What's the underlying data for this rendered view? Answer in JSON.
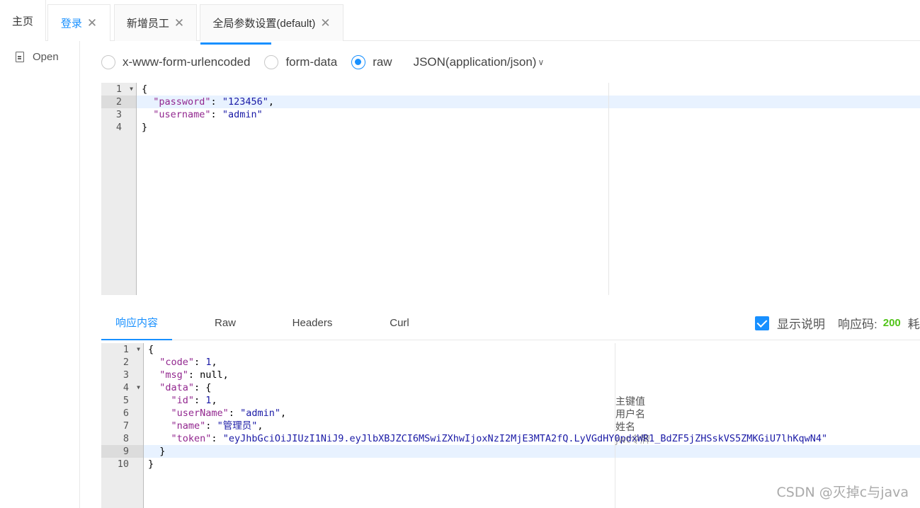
{
  "tabs": [
    {
      "label": "主页",
      "closable": false
    },
    {
      "label": "登录",
      "closable": true,
      "active": true
    },
    {
      "label": "新增员工",
      "closable": true
    },
    {
      "label": "全局参数设置(default)",
      "closable": true
    }
  ],
  "close_glyph": "✕",
  "sidebar": {
    "open_label": "Open",
    "icon": "file-icon"
  },
  "body_types": {
    "options": [
      "x-www-form-urlencoded",
      "form-data",
      "raw"
    ],
    "selected": "raw",
    "content_type": "JSON(application/json)",
    "chevron": "∨"
  },
  "request_editor": {
    "line_numbers": [
      "1",
      "2",
      "3",
      "4"
    ],
    "lines": [
      "{",
      "  \"password\": \"123456\",",
      "  \"username\": \"admin\"",
      "}"
    ]
  },
  "response_tabs": [
    "响应内容",
    "Raw",
    "Headers",
    "Curl"
  ],
  "response_meta": {
    "show_desc_label": "显示说明",
    "status_label": "响应码:",
    "status_code": "200",
    "time_label": "耗"
  },
  "response_editor": {
    "line_numbers": [
      "1",
      "2",
      "3",
      "4",
      "5",
      "6",
      "7",
      "8",
      "9",
      "10"
    ],
    "annotations": [
      "主键值",
      "用户名",
      "姓名",
      "jwt令牌"
    ]
  },
  "watermark": "CSDN @灭掉c与java",
  "colors": {
    "accent": "#1890ff",
    "status_ok": "#52c41a",
    "json_key": "#92278f",
    "json_value": "#1a1aa6"
  }
}
